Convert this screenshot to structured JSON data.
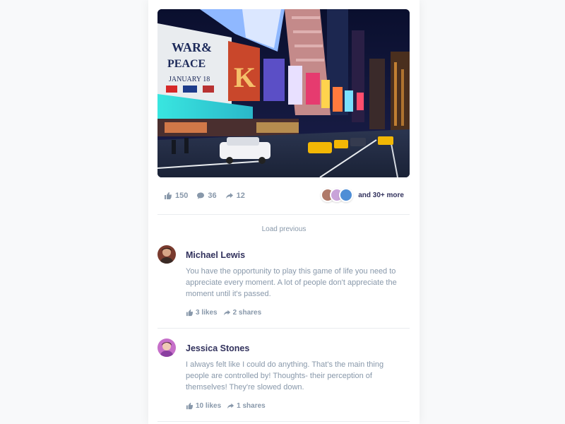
{
  "post": {
    "stats": {
      "likes": "150",
      "comments": "36",
      "shares": "12"
    },
    "reactors_text": "and 30+ more",
    "load_previous": "Load previous"
  },
  "comments": [
    {
      "name": "Michael Lewis",
      "text": "You have the opportunity to play this game of life you need to appreciate every moment. A lot of people don't appreciate the moment until it's passed.",
      "likes": "3 likes",
      "shares": "2 shares"
    },
    {
      "name": "Jessica Stones",
      "text": "I always felt like I could do anything. That's the main thing people are controlled by! Thoughts- their perception of themselves! They're slowed down.",
      "likes": "10 likes",
      "shares": "1 shares"
    }
  ],
  "icons": {
    "like": "thumbs-up-icon",
    "comment": "comment-bubble-icon",
    "share": "share-arrow-icon"
  },
  "colors": {
    "text_muted": "#8898aa",
    "text_heading": "#32325d",
    "divider": "#e9ecef"
  }
}
